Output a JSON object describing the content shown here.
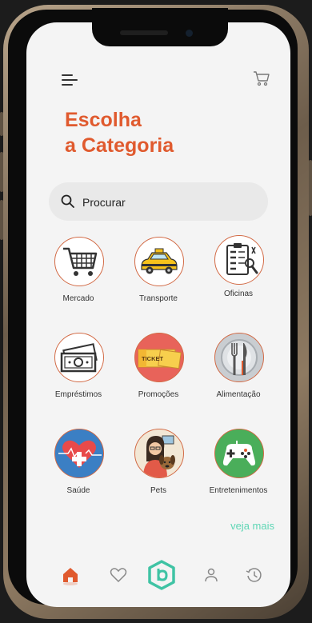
{
  "header": {
    "title_line1": "Escolha",
    "title_line2": "a Categoria"
  },
  "search": {
    "placeholder": "Procurar",
    "value": ""
  },
  "categories": [
    {
      "label": "Mercado",
      "icon": "shopping-cart-icon"
    },
    {
      "label": "Transporte",
      "icon": "taxi-icon"
    },
    {
      "label": "Oficinas",
      "icon": "repair-checklist-icon"
    },
    {
      "label": "Empréstimos",
      "icon": "money-icon"
    },
    {
      "label": "Promoções",
      "icon": "ticket-icon"
    },
    {
      "label": "Alimentação",
      "icon": "cutlery-icon"
    },
    {
      "label": "Saúde",
      "icon": "heart-health-icon"
    },
    {
      "label": "Pets",
      "icon": "pet-owner-icon"
    },
    {
      "label": "Entretenimentos",
      "icon": "gamepad-icon"
    }
  ],
  "more_link": "veja mais",
  "bottom_nav": [
    {
      "name": "home",
      "icon": "home-icon",
      "active": true
    },
    {
      "name": "favorites",
      "icon": "heart-icon",
      "active": false
    },
    {
      "name": "brand",
      "icon": "brand-logo-icon",
      "active": false
    },
    {
      "name": "profile",
      "icon": "user-icon",
      "active": false
    },
    {
      "name": "history",
      "icon": "history-icon",
      "active": false
    }
  ],
  "colors": {
    "accent": "#e05a2e",
    "link": "#5ed6b5",
    "brand": "#3fc3a4",
    "background": "#f4f4f4"
  }
}
